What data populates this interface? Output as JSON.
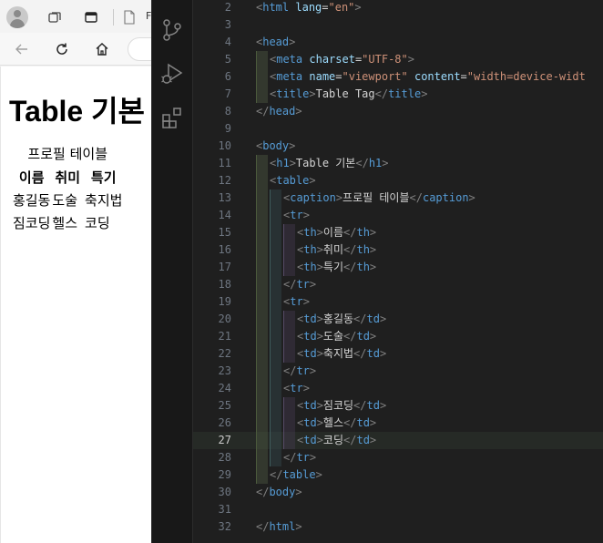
{
  "browser": {
    "tab_title": "F",
    "page": {
      "heading": "Table 기본",
      "table": {
        "caption": "프로필 테이블",
        "headers": [
          "이름",
          "취미",
          "특기"
        ],
        "rows": [
          [
            "홍길동",
            "도술",
            "축지법"
          ],
          [
            "짐코딩",
            "헬스",
            "코딩"
          ]
        ]
      }
    }
  },
  "editor": {
    "current_line": 27,
    "lines": [
      {
        "n": 2,
        "indent": 0,
        "guides": 0,
        "tokens": [
          {
            "t": "<",
            "c": "pu"
          },
          {
            "t": "html",
            "c": "tg"
          },
          {
            "t": " lang",
            "c": "an"
          },
          {
            "t": "=",
            "c": "tx"
          },
          {
            "t": "\"en\"",
            "c": "av"
          },
          {
            "t": ">",
            "c": "pu"
          }
        ]
      },
      {
        "n": 3,
        "indent": 0,
        "guides": 0,
        "tokens": []
      },
      {
        "n": 4,
        "indent": 0,
        "guides": 0,
        "tokens": [
          {
            "t": "<",
            "c": "pu"
          },
          {
            "t": "head",
            "c": "tg"
          },
          {
            "t": ">",
            "c": "pu"
          }
        ]
      },
      {
        "n": 5,
        "indent": 1,
        "guides": 1,
        "tokens": [
          {
            "t": "<",
            "c": "pu"
          },
          {
            "t": "meta",
            "c": "tg"
          },
          {
            "t": " charset",
            "c": "an"
          },
          {
            "t": "=",
            "c": "tx"
          },
          {
            "t": "\"UTF-8\"",
            "c": "av"
          },
          {
            "t": ">",
            "c": "pu"
          }
        ]
      },
      {
        "n": 6,
        "indent": 1,
        "guides": 1,
        "tokens": [
          {
            "t": "<",
            "c": "pu"
          },
          {
            "t": "meta",
            "c": "tg"
          },
          {
            "t": " name",
            "c": "an"
          },
          {
            "t": "=",
            "c": "tx"
          },
          {
            "t": "\"viewport\"",
            "c": "av"
          },
          {
            "t": " content",
            "c": "an"
          },
          {
            "t": "=",
            "c": "tx"
          },
          {
            "t": "\"width=device-widt",
            "c": "av"
          }
        ]
      },
      {
        "n": 7,
        "indent": 1,
        "guides": 1,
        "tokens": [
          {
            "t": "<",
            "c": "pu"
          },
          {
            "t": "title",
            "c": "tg"
          },
          {
            "t": ">",
            "c": "pu"
          },
          {
            "t": "Table Tag",
            "c": "tx"
          },
          {
            "t": "</",
            "c": "pu"
          },
          {
            "t": "title",
            "c": "tg"
          },
          {
            "t": ">",
            "c": "pu"
          }
        ]
      },
      {
        "n": 8,
        "indent": 0,
        "guides": 0,
        "tokens": [
          {
            "t": "</",
            "c": "pu"
          },
          {
            "t": "head",
            "c": "tg"
          },
          {
            "t": ">",
            "c": "pu"
          }
        ]
      },
      {
        "n": 9,
        "indent": 0,
        "guides": 0,
        "tokens": []
      },
      {
        "n": 10,
        "indent": 0,
        "guides": 0,
        "tokens": [
          {
            "t": "<",
            "c": "pu"
          },
          {
            "t": "body",
            "c": "tg"
          },
          {
            "t": ">",
            "c": "pu"
          }
        ]
      },
      {
        "n": 11,
        "indent": 1,
        "guides": 1,
        "tokens": [
          {
            "t": "<",
            "c": "pu"
          },
          {
            "t": "h1",
            "c": "tg"
          },
          {
            "t": ">",
            "c": "pu"
          },
          {
            "t": "Table 기본",
            "c": "tx"
          },
          {
            "t": "</",
            "c": "pu"
          },
          {
            "t": "h1",
            "c": "tg"
          },
          {
            "t": ">",
            "c": "pu"
          }
        ]
      },
      {
        "n": 12,
        "indent": 1,
        "guides": 1,
        "tokens": [
          {
            "t": "<",
            "c": "pu"
          },
          {
            "t": "table",
            "c": "tg"
          },
          {
            "t": ">",
            "c": "pu"
          }
        ]
      },
      {
        "n": 13,
        "indent": 2,
        "guides": 2,
        "tokens": [
          {
            "t": "<",
            "c": "pu"
          },
          {
            "t": "caption",
            "c": "tg"
          },
          {
            "t": ">",
            "c": "pu"
          },
          {
            "t": "프로필 테이블",
            "c": "tx"
          },
          {
            "t": "</",
            "c": "pu"
          },
          {
            "t": "caption",
            "c": "tg"
          },
          {
            "t": ">",
            "c": "pu"
          }
        ]
      },
      {
        "n": 14,
        "indent": 2,
        "guides": 2,
        "tokens": [
          {
            "t": "<",
            "c": "pu"
          },
          {
            "t": "tr",
            "c": "tg"
          },
          {
            "t": ">",
            "c": "pu"
          }
        ]
      },
      {
        "n": 15,
        "indent": 3,
        "guides": 3,
        "tokens": [
          {
            "t": "<",
            "c": "pu"
          },
          {
            "t": "th",
            "c": "tg"
          },
          {
            "t": ">",
            "c": "pu"
          },
          {
            "t": "이름",
            "c": "tx"
          },
          {
            "t": "</",
            "c": "pu"
          },
          {
            "t": "th",
            "c": "tg"
          },
          {
            "t": ">",
            "c": "pu"
          }
        ]
      },
      {
        "n": 16,
        "indent": 3,
        "guides": 3,
        "tokens": [
          {
            "t": "<",
            "c": "pu"
          },
          {
            "t": "th",
            "c": "tg"
          },
          {
            "t": ">",
            "c": "pu"
          },
          {
            "t": "취미",
            "c": "tx"
          },
          {
            "t": "</",
            "c": "pu"
          },
          {
            "t": "th",
            "c": "tg"
          },
          {
            "t": ">",
            "c": "pu"
          }
        ]
      },
      {
        "n": 17,
        "indent": 3,
        "guides": 3,
        "tokens": [
          {
            "t": "<",
            "c": "pu"
          },
          {
            "t": "th",
            "c": "tg"
          },
          {
            "t": ">",
            "c": "pu"
          },
          {
            "t": "특기",
            "c": "tx"
          },
          {
            "t": "</",
            "c": "pu"
          },
          {
            "t": "th",
            "c": "tg"
          },
          {
            "t": ">",
            "c": "pu"
          }
        ]
      },
      {
        "n": 18,
        "indent": 2,
        "guides": 2,
        "tokens": [
          {
            "t": "</",
            "c": "pu"
          },
          {
            "t": "tr",
            "c": "tg"
          },
          {
            "t": ">",
            "c": "pu"
          }
        ]
      },
      {
        "n": 19,
        "indent": 2,
        "guides": 2,
        "tokens": [
          {
            "t": "<",
            "c": "pu"
          },
          {
            "t": "tr",
            "c": "tg"
          },
          {
            "t": ">",
            "c": "pu"
          }
        ]
      },
      {
        "n": 20,
        "indent": 3,
        "guides": 3,
        "tokens": [
          {
            "t": "<",
            "c": "pu"
          },
          {
            "t": "td",
            "c": "tg"
          },
          {
            "t": ">",
            "c": "pu"
          },
          {
            "t": "홍길동",
            "c": "tx"
          },
          {
            "t": "</",
            "c": "pu"
          },
          {
            "t": "td",
            "c": "tg"
          },
          {
            "t": ">",
            "c": "pu"
          }
        ]
      },
      {
        "n": 21,
        "indent": 3,
        "guides": 3,
        "tokens": [
          {
            "t": "<",
            "c": "pu"
          },
          {
            "t": "td",
            "c": "tg"
          },
          {
            "t": ">",
            "c": "pu"
          },
          {
            "t": "도술",
            "c": "tx"
          },
          {
            "t": "</",
            "c": "pu"
          },
          {
            "t": "td",
            "c": "tg"
          },
          {
            "t": ">",
            "c": "pu"
          }
        ]
      },
      {
        "n": 22,
        "indent": 3,
        "guides": 3,
        "tokens": [
          {
            "t": "<",
            "c": "pu"
          },
          {
            "t": "td",
            "c": "tg"
          },
          {
            "t": ">",
            "c": "pu"
          },
          {
            "t": "축지법",
            "c": "tx"
          },
          {
            "t": "</",
            "c": "pu"
          },
          {
            "t": "td",
            "c": "tg"
          },
          {
            "t": ">",
            "c": "pu"
          }
        ]
      },
      {
        "n": 23,
        "indent": 2,
        "guides": 2,
        "tokens": [
          {
            "t": "</",
            "c": "pu"
          },
          {
            "t": "tr",
            "c": "tg"
          },
          {
            "t": ">",
            "c": "pu"
          }
        ]
      },
      {
        "n": 24,
        "indent": 2,
        "guides": 2,
        "tokens": [
          {
            "t": "<",
            "c": "pu"
          },
          {
            "t": "tr",
            "c": "tg"
          },
          {
            "t": ">",
            "c": "pu"
          }
        ]
      },
      {
        "n": 25,
        "indent": 3,
        "guides": 3,
        "tokens": [
          {
            "t": "<",
            "c": "pu"
          },
          {
            "t": "td",
            "c": "tg"
          },
          {
            "t": ">",
            "c": "pu"
          },
          {
            "t": "짐코딩",
            "c": "tx"
          },
          {
            "t": "</",
            "c": "pu"
          },
          {
            "t": "td",
            "c": "tg"
          },
          {
            "t": ">",
            "c": "pu"
          }
        ]
      },
      {
        "n": 26,
        "indent": 3,
        "guides": 3,
        "tokens": [
          {
            "t": "<",
            "c": "pu"
          },
          {
            "t": "td",
            "c": "tg"
          },
          {
            "t": ">",
            "c": "pu"
          },
          {
            "t": "헬스",
            "c": "tx"
          },
          {
            "t": "</",
            "c": "pu"
          },
          {
            "t": "td",
            "c": "tg"
          },
          {
            "t": ">",
            "c": "pu"
          }
        ]
      },
      {
        "n": 27,
        "indent": 3,
        "guides": 3,
        "tokens": [
          {
            "t": "<",
            "c": "pu"
          },
          {
            "t": "td",
            "c": "tg"
          },
          {
            "t": ">",
            "c": "pu"
          },
          {
            "t": "코딩",
            "c": "tx"
          },
          {
            "t": "</",
            "c": "pu"
          },
          {
            "t": "td",
            "c": "tg"
          },
          {
            "t": ">",
            "c": "pu"
          }
        ]
      },
      {
        "n": 28,
        "indent": 2,
        "guides": 2,
        "tokens": [
          {
            "t": "</",
            "c": "pu"
          },
          {
            "t": "tr",
            "c": "tg"
          },
          {
            "t": ">",
            "c": "pu"
          }
        ]
      },
      {
        "n": 29,
        "indent": 1,
        "guides": 1,
        "tokens": [
          {
            "t": "</",
            "c": "pu"
          },
          {
            "t": "table",
            "c": "tg"
          },
          {
            "t": ">",
            "c": "pu"
          }
        ]
      },
      {
        "n": 30,
        "indent": 0,
        "guides": 0,
        "tokens": [
          {
            "t": "</",
            "c": "pu"
          },
          {
            "t": "body",
            "c": "tg"
          },
          {
            "t": ">",
            "c": "pu"
          }
        ]
      },
      {
        "n": 31,
        "indent": 0,
        "guides": 0,
        "tokens": []
      },
      {
        "n": 32,
        "indent": 0,
        "guides": 0,
        "tokens": [
          {
            "t": "</",
            "c": "pu"
          },
          {
            "t": "html",
            "c": "tg"
          },
          {
            "t": ">",
            "c": "pu"
          }
        ]
      }
    ]
  },
  "icons": {
    "browser": [
      "avatar",
      "workspaces-icon",
      "tab-actions-icon",
      "page-icon",
      "back-icon",
      "refresh-icon",
      "home-icon"
    ],
    "activity_bar": [
      "source-control-icon",
      "run-debug-icon",
      "extensions-icon"
    ]
  }
}
